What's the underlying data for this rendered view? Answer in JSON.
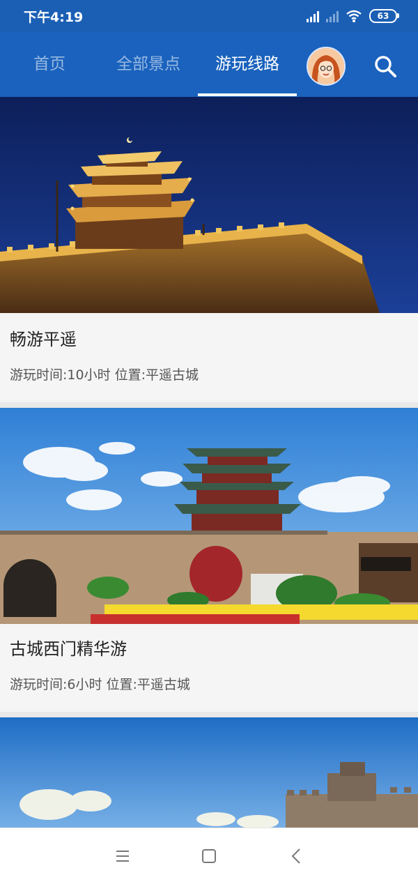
{
  "status_bar": {
    "time": "下午4:19",
    "battery": "63",
    "icons": [
      "signal-icon",
      "signal-icon-secondary",
      "wifi-icon",
      "battery-icon"
    ]
  },
  "header": {
    "tabs": [
      {
        "label": "首页",
        "active": false
      },
      {
        "label": "全部景点",
        "active": false
      },
      {
        "label": "游玩线路",
        "active": true
      }
    ],
    "avatar_icon": "avatar",
    "search_icon": "search-icon"
  },
  "routes": [
    {
      "title": "畅游平遥",
      "meta": "游玩时间:10小时 位置:平遥古城",
      "image": "night-gate-tower-photo"
    },
    {
      "title": "古城西门精华游",
      "meta": "游玩时间:6小时 位置:平遥古城",
      "image": "west-gate-daytime-photo"
    },
    {
      "title": "",
      "meta": "",
      "image": "city-wall-photo"
    }
  ],
  "nav_bar": {
    "icons": [
      "menu-icon",
      "home-icon",
      "back-icon"
    ]
  },
  "colors": {
    "primary": "#1a62bd",
    "status": "#1b5fb5",
    "background": "#e9e9e9"
  }
}
